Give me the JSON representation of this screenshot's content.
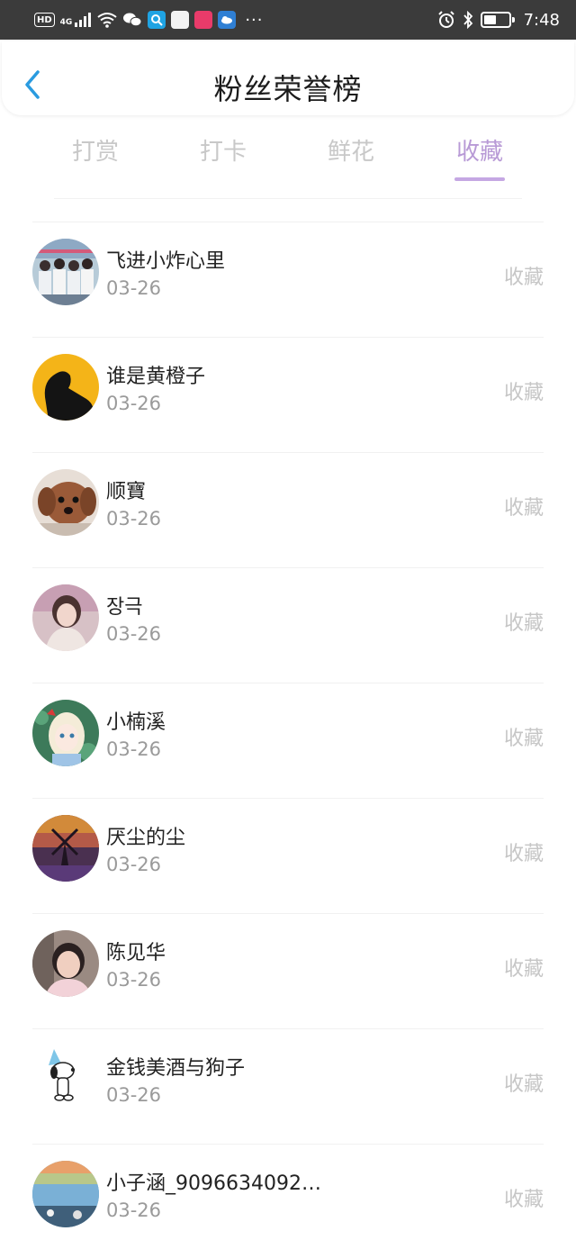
{
  "status_bar": {
    "hd": "HD",
    "signal_text": "4G",
    "dots": "···",
    "time": "7:48",
    "battery_level": 0.5
  },
  "header": {
    "title": "粉丝荣誉榜"
  },
  "tabs": [
    {
      "label": "打赏",
      "active": false
    },
    {
      "label": "打卡",
      "active": false
    },
    {
      "label": "鲜花",
      "active": false
    },
    {
      "label": "收藏",
      "active": true
    }
  ],
  "colors": {
    "accent": "#b89ad6",
    "back_arrow": "#2a9be0",
    "status_bar": "#3b3b3b"
  },
  "list": [
    {
      "name": "飞进小炸心里",
      "date": "03-26",
      "type": "收藏",
      "avatar": "group-photo-avatar"
    },
    {
      "name": "谁是黄橙子",
      "date": "03-26",
      "type": "收藏",
      "avatar": "silhouette-avatar"
    },
    {
      "name": "顺寶",
      "date": "03-26",
      "type": "收藏",
      "avatar": "dog-avatar"
    },
    {
      "name": "장극",
      "date": "03-26",
      "type": "收藏",
      "avatar": "portrait-avatar"
    },
    {
      "name": "小楠溪",
      "date": "03-26",
      "type": "收藏",
      "avatar": "anime-girl-avatar"
    },
    {
      "name": "厌尘的尘",
      "date": "03-26",
      "type": "收藏",
      "avatar": "windmill-avatar"
    },
    {
      "name": "陈见华",
      "date": "03-26",
      "type": "收藏",
      "avatar": "child-photo-avatar"
    },
    {
      "name": "金钱美酒与狗子",
      "date": "03-26",
      "type": "收藏",
      "avatar": "snoopy-avatar"
    },
    {
      "name": "小子涵_9096634092…",
      "date": "03-26",
      "type": "收藏",
      "avatar": "sunset-avatar"
    }
  ]
}
